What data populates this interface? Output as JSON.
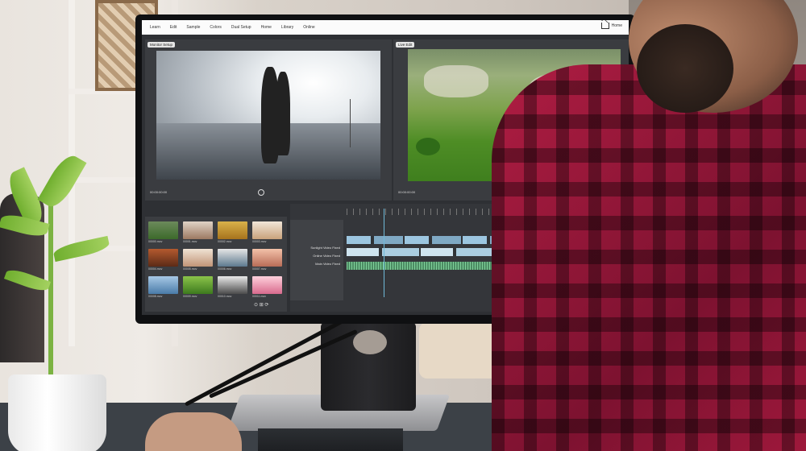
{
  "menubar": {
    "items": [
      "Learn",
      "Edit",
      "Sample",
      "Colors",
      "Dual Setup",
      "Home",
      "Library",
      "Online"
    ],
    "home_label": "Home"
  },
  "viewers": {
    "left_tab": "Monitor Setup",
    "right_tab": "Live Edit",
    "left_timecode": "00:00:00:00",
    "right_timecode": "00:00:00:00"
  },
  "timeline": {
    "track_labels": [
      "Sunlight Video Fixed",
      "Online Video Fixed",
      "Main Video Fixed"
    ]
  },
  "media_bin": {
    "thumbnail_labels": [
      "00000.mov",
      "00001.mov",
      "00002.mov",
      "00003.mov",
      "00004.mov",
      "00005.mov",
      "00006.mov",
      "00007.mov",
      "00008.mov",
      "00009.mov",
      "00010.mov",
      "00011.mov"
    ]
  },
  "colors": {
    "screen_bg": "#2e3034",
    "playhead": "#6fb9d8",
    "shirt": "#b01d43"
  }
}
